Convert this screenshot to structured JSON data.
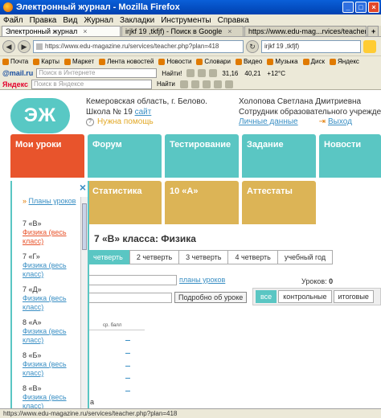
{
  "window": {
    "title": "Электронный журнал - Mozilla Firefox"
  },
  "menubar": [
    "Файл",
    "Правка",
    "Вид",
    "Журнал",
    "Закладки",
    "Инструменты",
    "Справка"
  ],
  "tabs": [
    {
      "label": "Электронный журнал",
      "active": true
    },
    {
      "label": "irjkf 19 ,tkfjf) - Поиск в Google",
      "active": false
    },
    {
      "label": "https://www.edu-mag...rvices/teacher.php",
      "active": false
    }
  ],
  "nav": {
    "url": "https://www.edu-magazine.ru/services/teacher.php?plan=418",
    "search": "irjkf 19 ,tkfjf)"
  },
  "bookmarks": [
    "Почта",
    "Карты",
    "Маркет",
    "Лента новостей",
    "Новости",
    "Словари",
    "Видео",
    "Музыка",
    "Диск",
    "Яндекс"
  ],
  "toolbar1": {
    "logo": "@mail.ru",
    "search_placeholder": "Поиск в Интернете",
    "find": "Найти!",
    "ticker1": "31,16",
    "ticker2": "40,21",
    "weather": "+12°C"
  },
  "toolbar2": {
    "logo": "Яндекс",
    "search_placeholder": "Поиск в Яндексе",
    "find": "Найти"
  },
  "site": {
    "logo": "ЭЖ",
    "region": "Кемеровская область, г. Белово.",
    "school": "Школа № 19",
    "site_link": "сайт",
    "help": "Нужна помощь",
    "user_name": "Холопова Светлана Дмитриевна",
    "user_role": "Сотрудник образовательного учреждения",
    "personal": "Личные данные",
    "exit": "Выход"
  },
  "menu": [
    "Мои уроки",
    "Форум",
    "Тестирование",
    "Задание",
    "Новости",
    "Статистика",
    "10 «А»",
    "Аттестаты"
  ],
  "dropdown": {
    "plans": "Планы уроков",
    "items": [
      {
        "cls": "7 «В»",
        "subject": "Физика (весь класс)",
        "active": true
      },
      {
        "cls": "7 «Г»",
        "subject": "Физика (весь класс)",
        "active": false
      },
      {
        "cls": "7 «Д»",
        "subject": "Физика (весь класс)",
        "active": false
      },
      {
        "cls": "8 «А»",
        "subject": "Физика (весь класс)",
        "active": false
      },
      {
        "cls": "8 «Б»",
        "subject": "Физика (весь класс)",
        "active": false
      },
      {
        "cls": "8 «В»",
        "subject": "Физика (весь класс)",
        "active": false
      },
      {
        "cls": "8 «А»",
        "subject": "",
        "active": false
      }
    ]
  },
  "main": {
    "title": "7 «В» класса: Физика",
    "quarters": [
      "четверть",
      "2 четверть",
      "3 четверть",
      "4 четверть",
      "учебный год"
    ],
    "plans_link": "планы уроков",
    "about_btn": "Подробно об уроке",
    "lessons_label": "Уроков:",
    "lessons_value": "0",
    "filters": [
      "все",
      "контрольные",
      "итоговые"
    ],
    "table_head": "ср. балл",
    "cut_text": "а"
  },
  "status": "https://www.edu-magazine.ru/services/teacher.php?plan=418",
  "colors": {
    "teal": "#5ac6c3",
    "orange": "#e8542c",
    "gold": "#dcb456",
    "link": "#3a8fc4"
  }
}
